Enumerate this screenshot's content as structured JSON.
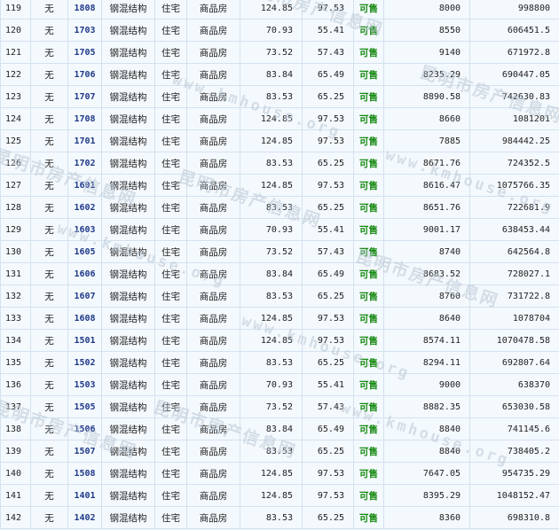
{
  "columns": [
    "seq",
    "mortgage",
    "room",
    "structure",
    "usage",
    "type",
    "build_area",
    "inner_area",
    "status",
    "price",
    "total"
  ],
  "rows": [
    [
      "119",
      "无",
      "1808",
      "钢混结构",
      "住宅",
      "商品房",
      "124.85",
      "97.53",
      "可售",
      "8000",
      "998800"
    ],
    [
      "120",
      "无",
      "1703",
      "钢混结构",
      "住宅",
      "商品房",
      "70.93",
      "55.41",
      "可售",
      "8550",
      "606451.5"
    ],
    [
      "121",
      "无",
      "1705",
      "钢混结构",
      "住宅",
      "商品房",
      "73.52",
      "57.43",
      "可售",
      "9140",
      "671972.8"
    ],
    [
      "122",
      "无",
      "1706",
      "钢混结构",
      "住宅",
      "商品房",
      "83.84",
      "65.49",
      "可售",
      "8235.29",
      "690447.05"
    ],
    [
      "123",
      "无",
      "1707",
      "钢混结构",
      "住宅",
      "商品房",
      "83.53",
      "65.25",
      "可售",
      "8890.58",
      "742630.83"
    ],
    [
      "124",
      "无",
      "1708",
      "钢混结构",
      "住宅",
      "商品房",
      "124.85",
      "97.53",
      "可售",
      "8660",
      "1081201"
    ],
    [
      "125",
      "无",
      "1701",
      "钢混结构",
      "住宅",
      "商品房",
      "124.85",
      "97.53",
      "可售",
      "7885",
      "984442.25"
    ],
    [
      "126",
      "无",
      "1702",
      "钢混结构",
      "住宅",
      "商品房",
      "83.53",
      "65.25",
      "可售",
      "8671.76",
      "724352.5"
    ],
    [
      "127",
      "无",
      "1601",
      "钢混结构",
      "住宅",
      "商品房",
      "124.85",
      "97.53",
      "可售",
      "8616.47",
      "1075766.35"
    ],
    [
      "128",
      "无",
      "1602",
      "钢混结构",
      "住宅",
      "商品房",
      "83.53",
      "65.25",
      "可售",
      "8651.76",
      "722681.9"
    ],
    [
      "129",
      "无",
      "1603",
      "钢混结构",
      "住宅",
      "商品房",
      "70.93",
      "55.41",
      "可售",
      "9001.17",
      "638453.44"
    ],
    [
      "130",
      "无",
      "1605",
      "钢混结构",
      "住宅",
      "商品房",
      "73.52",
      "57.43",
      "可售",
      "8740",
      "642564.8"
    ],
    [
      "131",
      "无",
      "1606",
      "钢混结构",
      "住宅",
      "商品房",
      "83.84",
      "65.49",
      "可售",
      "8683.52",
      "728027.1"
    ],
    [
      "132",
      "无",
      "1607",
      "钢混结构",
      "住宅",
      "商品房",
      "83.53",
      "65.25",
      "可售",
      "8760",
      "731722.8"
    ],
    [
      "133",
      "无",
      "1608",
      "钢混结构",
      "住宅",
      "商品房",
      "124.85",
      "97.53",
      "可售",
      "8640",
      "1078704"
    ],
    [
      "134",
      "无",
      "1501",
      "钢混结构",
      "住宅",
      "商品房",
      "124.85",
      "97.53",
      "可售",
      "8574.11",
      "1070478.58"
    ],
    [
      "135",
      "无",
      "1502",
      "钢混结构",
      "住宅",
      "商品房",
      "83.53",
      "65.25",
      "可售",
      "8294.11",
      "692807.64"
    ],
    [
      "136",
      "无",
      "1503",
      "钢混结构",
      "住宅",
      "商品房",
      "70.93",
      "55.41",
      "可售",
      "9000",
      "638370"
    ],
    [
      "137",
      "无",
      "1505",
      "钢混结构",
      "住宅",
      "商品房",
      "73.52",
      "57.43",
      "可售",
      "8882.35",
      "653030.58"
    ],
    [
      "138",
      "无",
      "1506",
      "钢混结构",
      "住宅",
      "商品房",
      "83.84",
      "65.49",
      "可售",
      "8840",
      "741145.6"
    ],
    [
      "139",
      "无",
      "1507",
      "钢混结构",
      "住宅",
      "商品房",
      "83.53",
      "65.25",
      "可售",
      "8840",
      "738405.2"
    ],
    [
      "140",
      "无",
      "1508",
      "钢混结构",
      "住宅",
      "商品房",
      "124.85",
      "97.53",
      "可售",
      "7647.05",
      "954735.29"
    ],
    [
      "141",
      "无",
      "1401",
      "钢混结构",
      "住宅",
      "商品房",
      "124.85",
      "97.53",
      "可售",
      "8395.29",
      "1048152.47"
    ],
    [
      "142",
      "无",
      "1402",
      "钢混结构",
      "住宅",
      "商品房",
      "83.53",
      "65.25",
      "可售",
      "8360",
      "698310.8"
    ]
  ],
  "watermark": {
    "text": "昆明市房产信息网",
    "url": "www.kmhouse.org"
  }
}
